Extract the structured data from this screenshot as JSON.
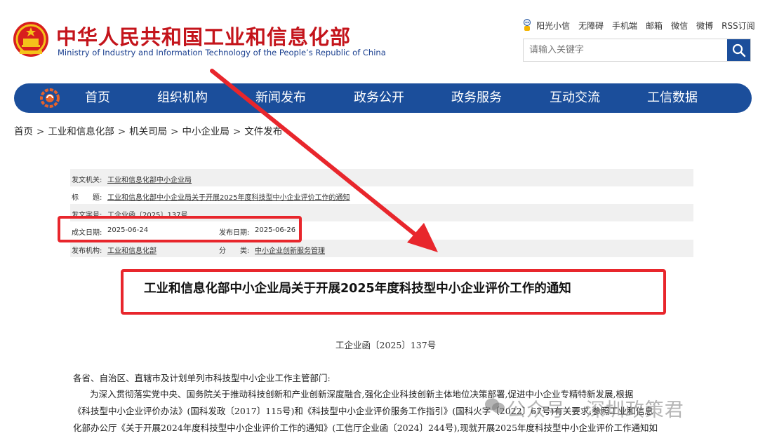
{
  "header": {
    "title": "中华人民共和国工业和信息化部",
    "subtitle": "Ministry of Industry and Information Technology of the People’s Republic of China",
    "links": [
      "阳光小信",
      "无障碍",
      "手机端",
      "邮箱",
      "微信",
      "微博",
      "RSS订阅"
    ],
    "search_placeholder": "请输入关键字"
  },
  "nav": {
    "items": [
      "首页",
      "组织机构",
      "新闻发布",
      "政务公开",
      "政务服务",
      "互动交流",
      "工信数据"
    ],
    "accent": "#1b4e9b"
  },
  "breadcrumb": [
    "首页",
    "工业和信息化部",
    "机关司局",
    "中小企业局",
    "文件发布"
  ],
  "meta": {
    "issuer_label": "发文机关:",
    "issuer": "工业和信息化部中小企业局",
    "title_label": "标　　题:",
    "title": "工业和信息化部中小企业局关于开展2025年度科技型中小企业评价工作的通知",
    "docno_label": "发文字号:",
    "docno": "工企业函〔2025〕137号",
    "written_label": "成文日期:",
    "written": "2025-06-24",
    "published_label": "发布日期:",
    "published": "2025-06-26",
    "org_label": "发布机构:",
    "org": "工业和信息化部",
    "category_label": "分　　类:",
    "category": "中小企业创新服务管理"
  },
  "document": {
    "title": "工业和信息化部中小企业局关于开展2025年度科技型中小企业评价工作的通知",
    "number": "工企业函〔2025〕137号",
    "salutation": "各省、自治区、直辖市及计划单列市科技型中小企业工作主管部门:",
    "para_line1": "为深入贯彻落实党中央、国务院关于推动科技创新和产业创新深度融合,强化企业科技创新主体地位决策部署,促进中小企业专精特新发展,根据",
    "para_line2": "《科技型中小企业评价办法》(国科发政〔2017〕115号)和《科技型中小企业评价服务工作指引》(国科火字〔2022〕67号)有关要求,参照工业和信息",
    "para_line3": "化部办公厅《关于开展2024年度科技型中小企业评价工作的通知》(工信厅企业函〔2024〕244号),现就开展2025年度科技型中小企业评价工作通知如"
  },
  "watermark": "公众号 · 深圳政策君",
  "colors": {
    "brand_red": "#c4141b",
    "highlight_red": "#e8262c",
    "nav_blue": "#1b4e9b"
  }
}
